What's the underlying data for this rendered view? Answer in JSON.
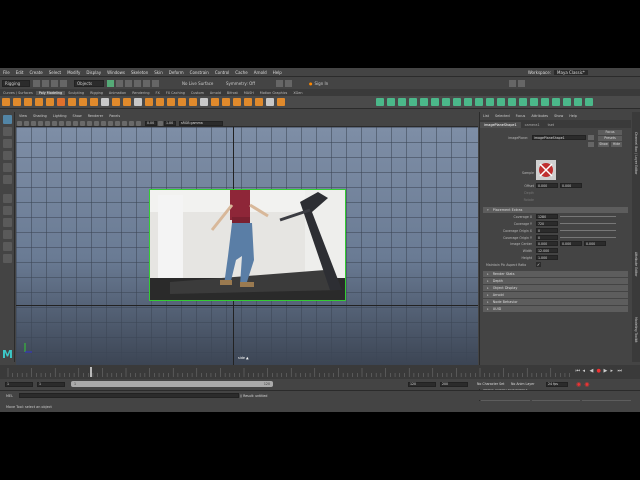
{
  "menubar": {
    "items": [
      "File",
      "Edit",
      "Create",
      "Select",
      "Modify",
      "Display",
      "Windows",
      "Skeleton",
      "Skin",
      "Deform",
      "Constrain",
      "Control",
      "Cache",
      "Arnold",
      "Help"
    ],
    "workspace_label": "Workspace:",
    "workspace_value": "Maya Classic*"
  },
  "statusline": {
    "menuset": "Rigging",
    "objects": "Objects",
    "no_live_surface": "No Live Surface",
    "symmetry": "Symmetry: Off",
    "signin": "Sign In"
  },
  "shelf": {
    "tabs": [
      "Curves / Surfaces",
      "Poly Modeling",
      "Sculpting",
      "Rigging",
      "Animation",
      "Rendering",
      "FX",
      "FX Caching",
      "Custom",
      "Arnold",
      "Bifrost",
      "MASH",
      "Motion Graphics",
      "XGen"
    ],
    "active_tab": "Poly Modeling",
    "icon_colors": [
      "#e08a2c",
      "#e08a2c",
      "#e08a2c",
      "#e08a2c",
      "#e08a2c",
      "#e0702c",
      "#e08a2c",
      "#e08a2c",
      "#e08a2c",
      "#c8c8c8",
      "#e08a2c",
      "#e08a2c",
      "#c8c8c8",
      "#e08a2c",
      "#e08a2c",
      "#e08a2c",
      "#e08a2c",
      "#e08a2c",
      "#c8c8c8",
      "#e08a2c",
      "#e08a2c",
      "#e08a2c",
      "#e08a2c",
      "#e08a2c",
      "#c8c8c8",
      "#e08a2c",
      "#4bb88a",
      "#4bb88a",
      "#4bb88a",
      "#4bb88a",
      "#4bb88a",
      "#4bb88a",
      "#4bb88a",
      "#4bb88a",
      "#4bb88a",
      "#4bb88a",
      "#4bb88a",
      "#4bb88a",
      "#4bb88a",
      "#4bb88a",
      "#4bb88a",
      "#4bb88a",
      "#4bb88a",
      "#4bb88a",
      "#4bb88a",
      "#4bb88a"
    ]
  },
  "panel": {
    "menu": [
      "View",
      "Shading",
      "Lighting",
      "Show",
      "Renderer",
      "Panels"
    ],
    "gamma_value": "0.00",
    "exposure_value": "1.00",
    "color_space": "sRGB gamma",
    "camera_label": "side ▲"
  },
  "attribute_editor": {
    "menu": [
      "List",
      "Selected",
      "Focus",
      "Attributes",
      "Show",
      "Help"
    ],
    "tabs": [
      "imagePlaneShape1",
      "camera1",
      "tset"
    ],
    "active_tab": "imagePlaneShape1",
    "imageplane_label": "imagePlane:",
    "imageplane_value": "imagePlaneShape1",
    "focus_btn": "Focus",
    "presets_btn": "Presets",
    "show_btn": "Show",
    "hide_btn": "Hide",
    "sample_label": "Sample",
    "offset_label": "Offset",
    "offset_x": "0.000",
    "offset_y": "0.000",
    "depth_label": "Depth",
    "rotate_label": "Rotate",
    "placement_extras": "Placement Extras",
    "rows": [
      {
        "label": "Coverage X",
        "value": "1280"
      },
      {
        "label": "Coverage Y",
        "value": "720"
      },
      {
        "label": "Coverage Origin X",
        "value": "0"
      },
      {
        "label": "Coverage Origin Y",
        "value": "0"
      }
    ],
    "image_center_label": "Image Center",
    "image_center": [
      "0.000",
      "0.000",
      "0.000"
    ],
    "width_label": "Width",
    "width_value": "12.000",
    "height_label": "Height",
    "height_value": "1.000",
    "maintain_ratio": "Maintain Pic Aspect Ratio",
    "sections": [
      "Render Stats",
      "Depth",
      "Object Display",
      "Arnold",
      "Node Behavior",
      "UUID"
    ],
    "notes_label": "Notes: imagePlaneShape1",
    "buttons": [
      "Select",
      "Load Attributes",
      "Copy Tab"
    ]
  },
  "side_tabs": [
    "Channel Box / Layer Editor",
    "Attribute Editor",
    "Modeling Toolkit"
  ],
  "timeslider": {
    "start_frame": "1",
    "current_start": "1",
    "range_left": "1",
    "range_right": "120",
    "end_frame": "120",
    "max_frame": "200",
    "no_character": "No Character Set",
    "no_anim_layer": "No Anim Layer",
    "fps": "24 fps"
  },
  "cmdline": {
    "lang_label": "MEL",
    "result": "// Result: untitled"
  },
  "helpline": {
    "text": "Move Tool: select an object"
  }
}
